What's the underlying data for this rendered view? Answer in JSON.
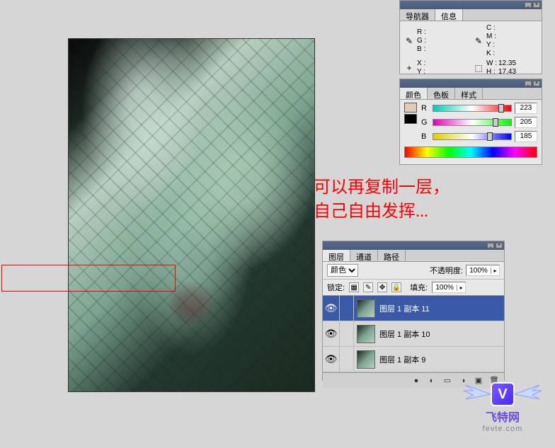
{
  "info_panel": {
    "tabs": [
      "导航器",
      "信息"
    ],
    "rgb": {
      "R": "R :",
      "G": "G :",
      "B": "B :"
    },
    "cmyk": {
      "C": "C :",
      "M": "M :",
      "Y": "Y :",
      "K": "K :"
    },
    "xy": {
      "X": "X :",
      "Y": "Y :"
    },
    "wh": {
      "W": "W :",
      "H": "H :",
      "Wv": "12.35",
      "Hv": "17.43"
    }
  },
  "color_panel": {
    "tabs": [
      "颜色",
      "色板",
      "样式"
    ],
    "R": {
      "label": "R",
      "value": "223"
    },
    "G": {
      "label": "G",
      "value": "205"
    },
    "B": {
      "label": "B",
      "value": "185"
    }
  },
  "annotation": {
    "line1": "可以再复制一层，",
    "line2": "自己自由发挥..."
  },
  "layers_panel": {
    "tabs": [
      "图层",
      "通道",
      "路径"
    ],
    "blend_label": "颜色",
    "opacity_label": "不透明度:",
    "opacity_value": "100%",
    "lock_label": "锁定:",
    "fill_label": "填充:",
    "fill_value": "100%",
    "layers": [
      {
        "name": "图层 1 副本 11",
        "selected": true
      },
      {
        "name": "图层 1 副本 10",
        "selected": false
      },
      {
        "name": "图层 1 副本 9",
        "selected": false
      }
    ]
  },
  "watermark": {
    "brand": "飞特网",
    "url": "fevte.com",
    "v": "V"
  }
}
